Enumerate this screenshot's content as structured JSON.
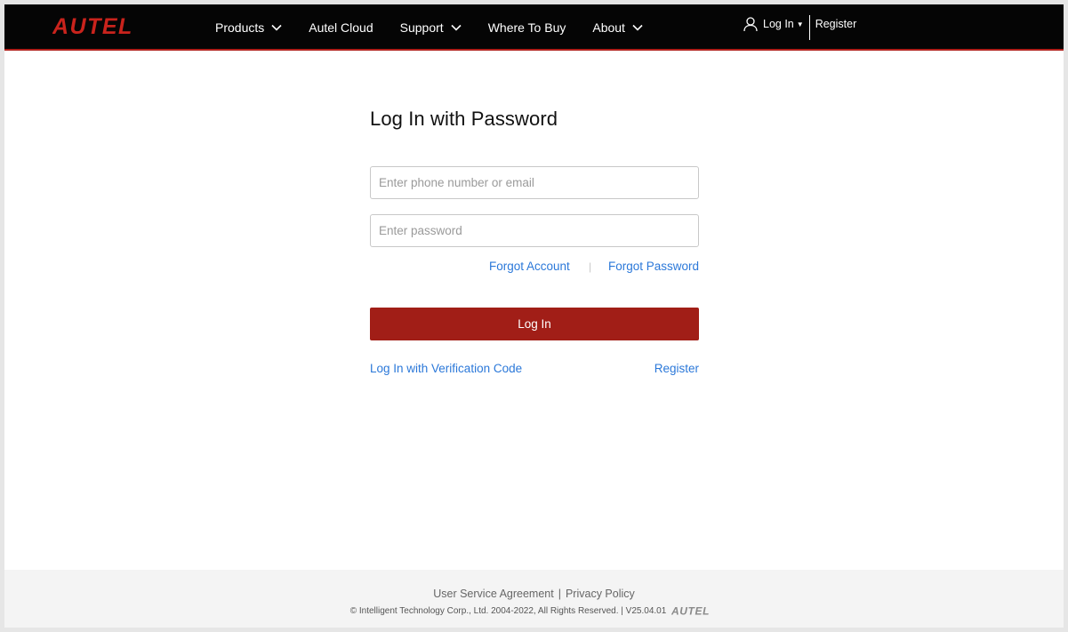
{
  "header": {
    "logo_text": "AUTEL",
    "nav": [
      {
        "label": "Products",
        "has_dropdown": true
      },
      {
        "label": "Autel Cloud",
        "has_dropdown": false
      },
      {
        "label": "Support",
        "has_dropdown": true
      },
      {
        "label": "Where To Buy",
        "has_dropdown": false
      },
      {
        "label": "About",
        "has_dropdown": true
      }
    ],
    "account": {
      "login_label": "Log In",
      "register_label": "Register",
      "user_icon": "user-icon"
    }
  },
  "login": {
    "title": "Log In with Password",
    "username_placeholder": "Enter phone number or email",
    "username_value": "",
    "password_placeholder": "Enter password",
    "password_value": "",
    "forgot_account": "Forgot Account",
    "separator": "|",
    "forgot_password": "Forgot Password",
    "submit_label": "Log In",
    "verification_link": "Log In with Verification Code",
    "register_link": "Register"
  },
  "footer": {
    "user_agreement": "User Service Agreement",
    "separator": "|",
    "privacy_policy": "Privacy Policy",
    "copyright": "© Intelligent Technology Corp., Ltd. 2004-2022, All Rights Reserved. | V25.04.01",
    "logo_text": "AUTEL"
  },
  "colors": {
    "header_bg": "#050505",
    "brand_red": "#c9231c",
    "button_red": "#a11e17",
    "link_blue": "#2b78d9",
    "footer_bg": "#f4f4f4"
  }
}
